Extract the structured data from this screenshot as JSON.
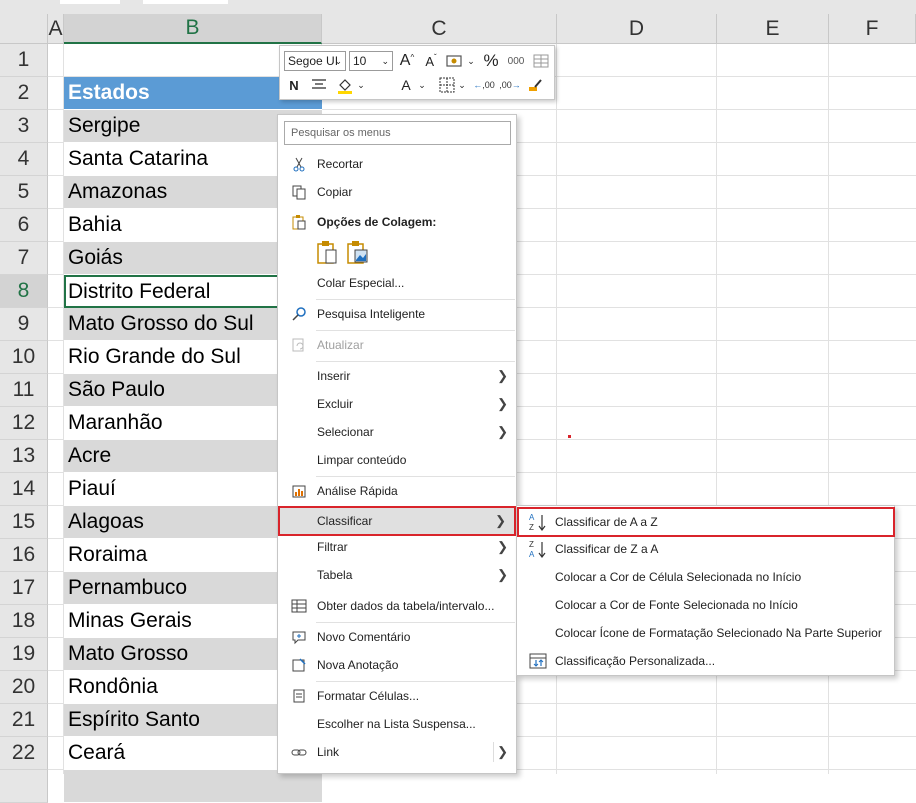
{
  "columns": [
    "A",
    "B",
    "C",
    "D",
    "E",
    "F"
  ],
  "rows": [
    "1",
    "2",
    "3",
    "4",
    "5",
    "6",
    "7",
    "8",
    "9",
    "10",
    "11",
    "12",
    "13",
    "14",
    "15",
    "16",
    "17",
    "18",
    "19",
    "20",
    "21",
    "22"
  ],
  "cells": {
    "header": "Estados",
    "states": [
      "Sergipe",
      "Santa Catarina",
      "Amazonas",
      "Bahia",
      "Goiás",
      "Distrito Federal",
      "Mato Grosso do Sul",
      "Rio Grande do Sul",
      "São Paulo",
      "Maranhão",
      "Acre",
      "Piauí",
      "Alagoas",
      "Roraima",
      "Pernambuco",
      "Minas Gerais",
      "Mato Grosso",
      "Rondônia",
      "Espírito Santo",
      "Ceará"
    ]
  },
  "mini_toolbar": {
    "font_name": "Segoe UI",
    "font_size": "10",
    "grow_font": "A",
    "shrink_font": "A",
    "percent": "%",
    "thousands": "000",
    "bold": "N",
    "font_color_letter": "A",
    "inc_decimal_label": ",00",
    "dec_decimal_label": ",00"
  },
  "context_menu": {
    "search_placeholder": "Pesquisar os menus",
    "items": {
      "cut": "Recortar",
      "copy": "Copiar",
      "paste_options": "Opções de Colagem:",
      "paste_special": "Colar Especial...",
      "smart_lookup": "Pesquisa Inteligente",
      "refresh": "Atualizar",
      "insert": "Inserir",
      "delete": "Excluir",
      "select": "Selecionar",
      "clear": "Limpar conteúdo",
      "quick_analysis": "Análise Rápida",
      "sort": "Classificar",
      "filter": "Filtrar",
      "table": "Tabela",
      "get_data": "Obter dados da tabela/intervalo...",
      "new_comment": "Novo Comentário",
      "new_note": "Nova Anotação",
      "format_cells": "Formatar Células...",
      "pick_list": "Escolher na Lista Suspensa...",
      "link": "Link"
    }
  },
  "sort_submenu": {
    "items": {
      "a_to_z": "Classificar de A a Z",
      "z_to_a": "Classificar de Z a A",
      "cell_color": "Colocar a Cor de Célula Selecionada no Início",
      "font_color": "Colocar a Cor de Fonte Selecionada no Início",
      "icon_top": "Colocar Ícone de Formatação Selecionado Na Parte Superior",
      "custom": "Classificação Personalizada..."
    }
  },
  "colors": {
    "header_fill": "#5b9bd5",
    "band_fill": "#d9d9d9",
    "active_border": "#217346",
    "highlight_box": "#d9242b"
  }
}
